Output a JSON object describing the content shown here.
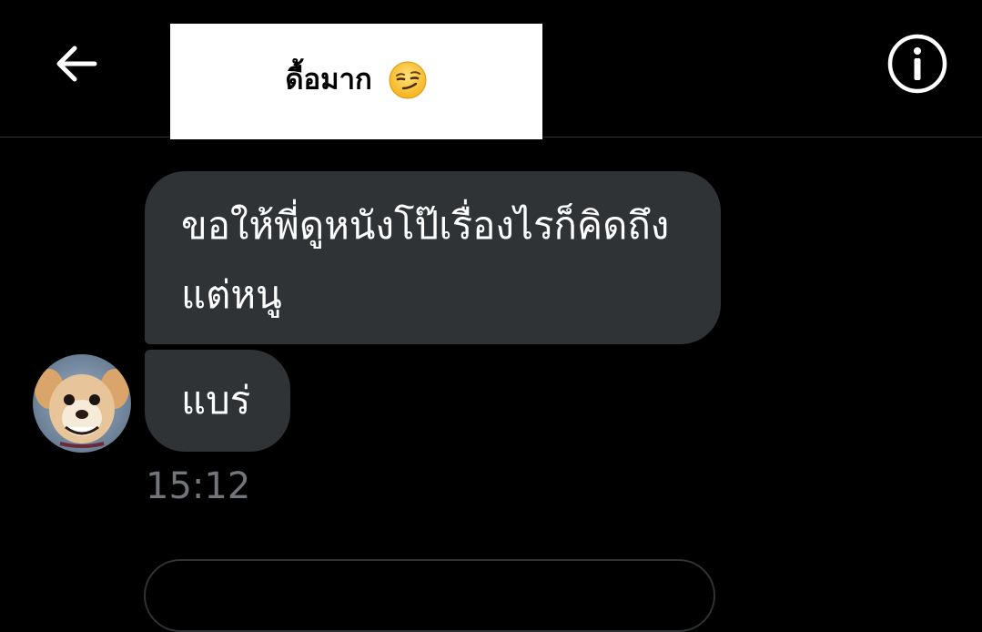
{
  "header": {
    "title": "ดื้อมาก",
    "title_emoji_icon": "smirking-face-icon",
    "back_icon": "arrow-left-icon",
    "info_icon": "info-icon"
  },
  "messages": [
    {
      "text": "ขอให้พี่ดูหนังโป๊เรื่องไรก็คิดถึงแต่หนู"
    },
    {
      "text": "แบร่"
    }
  ],
  "timestamp": "15:12",
  "colors": {
    "background": "#000000",
    "bubble": "#2f3336",
    "timestamp": "#71767b",
    "text": "#ffffff"
  }
}
